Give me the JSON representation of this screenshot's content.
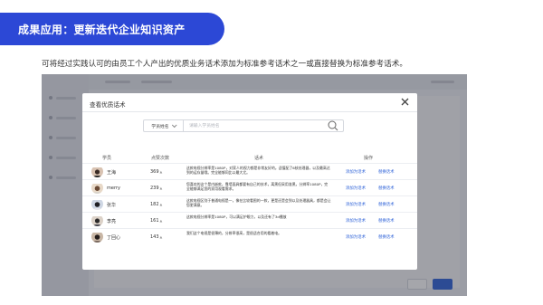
{
  "slide": {
    "title": "成果应用：更新迭代企业知识资产",
    "description": "可将经过实践认可的由员工个人产出的优质业务话术添加为标准参考话术之一或直接替换为标准参考话术。"
  },
  "modal": {
    "title": "查看优质话术",
    "search": {
      "select_value": "学员姓名",
      "placeholder": "请输入学员姓名"
    },
    "columns": {
      "student": "学员",
      "count": "点赞次数",
      "script": "话术",
      "actions": "操作"
    },
    "rows": [
      {
        "name": "王海",
        "count": "369",
        "script": "这款电视分辨率是1080P，对家人的视力都是非常友好的。适值配了6核处理器，以及最高达到的运存量哦。完全能够同比以最大尤。",
        "add_label": "添加为话术",
        "replace_label": "替换话术"
      },
      {
        "name": "merry",
        "count": "239",
        "script": "您喜欢的这个是内嵌款，靠墙面具都要有自己的技术，离黑但采用准黑，分辨率1080P，完全能够满足您的家用观看需求。",
        "add_label": "添加为话术",
        "replace_label": "替换话术"
      },
      {
        "name": "张华",
        "count": "182",
        "script": "这款电视区别于普通电视是一，像在比较看图的一款，更是还是会到以及处理器具，都是会让您更满意。",
        "add_label": "添加为话术",
        "replace_label": "替换话术"
      },
      {
        "name": "李亮",
        "count": "161",
        "script": "这款电视分辨率是1080P，可以满足护眼力，以及还有了3d播放",
        "add_label": "添加为话术",
        "replace_label": "替换话术"
      },
      {
        "name": "丁回心",
        "count": "143",
        "script": "我们这个电视是很薄的，分辨率很高，是很适合用的看着电。",
        "add_label": "添加为话术",
        "replace_label": "替换话术"
      }
    ]
  },
  "colors": {
    "banner": "#2c48d6",
    "link": "#2f63d8"
  },
  "icons": {
    "close": "close-icon",
    "search": "search-icon",
    "chevron": "chevron-down-icon",
    "sort": "sort-arrow-icon"
  }
}
